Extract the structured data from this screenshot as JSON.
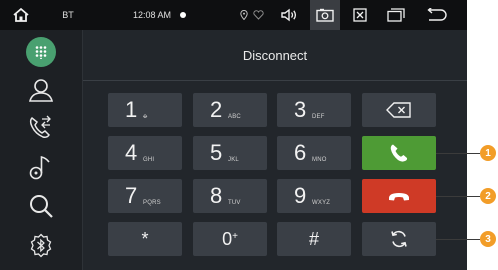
{
  "status_bar": {
    "bt_label": "BT",
    "time": "12:08 AM"
  },
  "header": {
    "title": "Disconnect"
  },
  "keypad": {
    "keys": [
      {
        "digit": "1",
        "sub": "ꝋ"
      },
      {
        "digit": "2",
        "sub": "ABC"
      },
      {
        "digit": "3",
        "sub": "DEF"
      },
      {
        "digit": "4",
        "sub": "GHI"
      },
      {
        "digit": "5",
        "sub": "JKL"
      },
      {
        "digit": "6",
        "sub": "MNO"
      },
      {
        "digit": "7",
        "sub": "PQRS"
      },
      {
        "digit": "8",
        "sub": "TUV"
      },
      {
        "digit": "9",
        "sub": "WXYZ"
      },
      {
        "digit": "*",
        "sub": ""
      },
      {
        "digit": "0",
        "sup": "+"
      },
      {
        "digit": "#",
        "sub": ""
      }
    ]
  },
  "callouts": [
    "1",
    "2",
    "3"
  ],
  "colors": {
    "accent_green": "#49a070",
    "call_green": "#4e9b35",
    "hangup_red": "#cf3a26",
    "callout_orange": "#f29d28"
  },
  "icons": {
    "status_bar": [
      "home-icon",
      "location-icon",
      "heart-icon",
      "volume-icon",
      "screenshot-icon",
      "close-box-icon",
      "recent-apps-icon",
      "back-icon"
    ],
    "sidebar": [
      "dialpad-icon",
      "contacts-icon",
      "call-log-icon",
      "music-icon",
      "search-icon",
      "bluetooth-settings-icon"
    ],
    "keypad_actions": [
      "backspace-icon",
      "call-icon",
      "hang-up-icon",
      "switch-icon"
    ]
  }
}
